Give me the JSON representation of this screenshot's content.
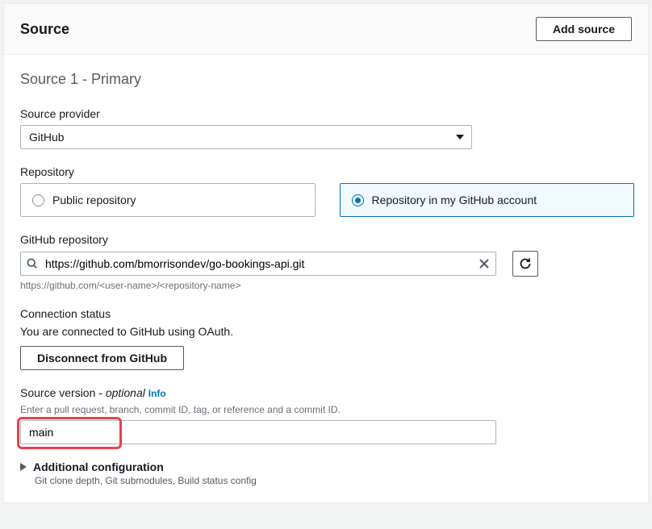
{
  "header": {
    "title": "Source",
    "add_button": "Add source"
  },
  "section": {
    "heading": "Source 1 - Primary"
  },
  "provider": {
    "label": "Source provider",
    "value": "GitHub"
  },
  "repository": {
    "label": "Repository",
    "options": {
      "public": "Public repository",
      "my_account": "Repository in my GitHub account"
    }
  },
  "github_repo": {
    "label": "GitHub repository",
    "value": "https://github.com/bmorrisondev/go-bookings-api.git",
    "hint": "https://github.com/<user-name>/<repository-name>"
  },
  "connection": {
    "label": "Connection status",
    "status": "You are connected to GitHub using OAuth.",
    "disconnect": "Disconnect from GitHub"
  },
  "source_version": {
    "label": "Source version - ",
    "optional": "optional",
    "info": "Info",
    "hint": "Enter a pull request, branch, commit ID, tag, or reference and a commit ID.",
    "value": "main"
  },
  "additional": {
    "label": "Additional configuration",
    "sub": "Git clone depth, Git submodules, Build status config"
  }
}
